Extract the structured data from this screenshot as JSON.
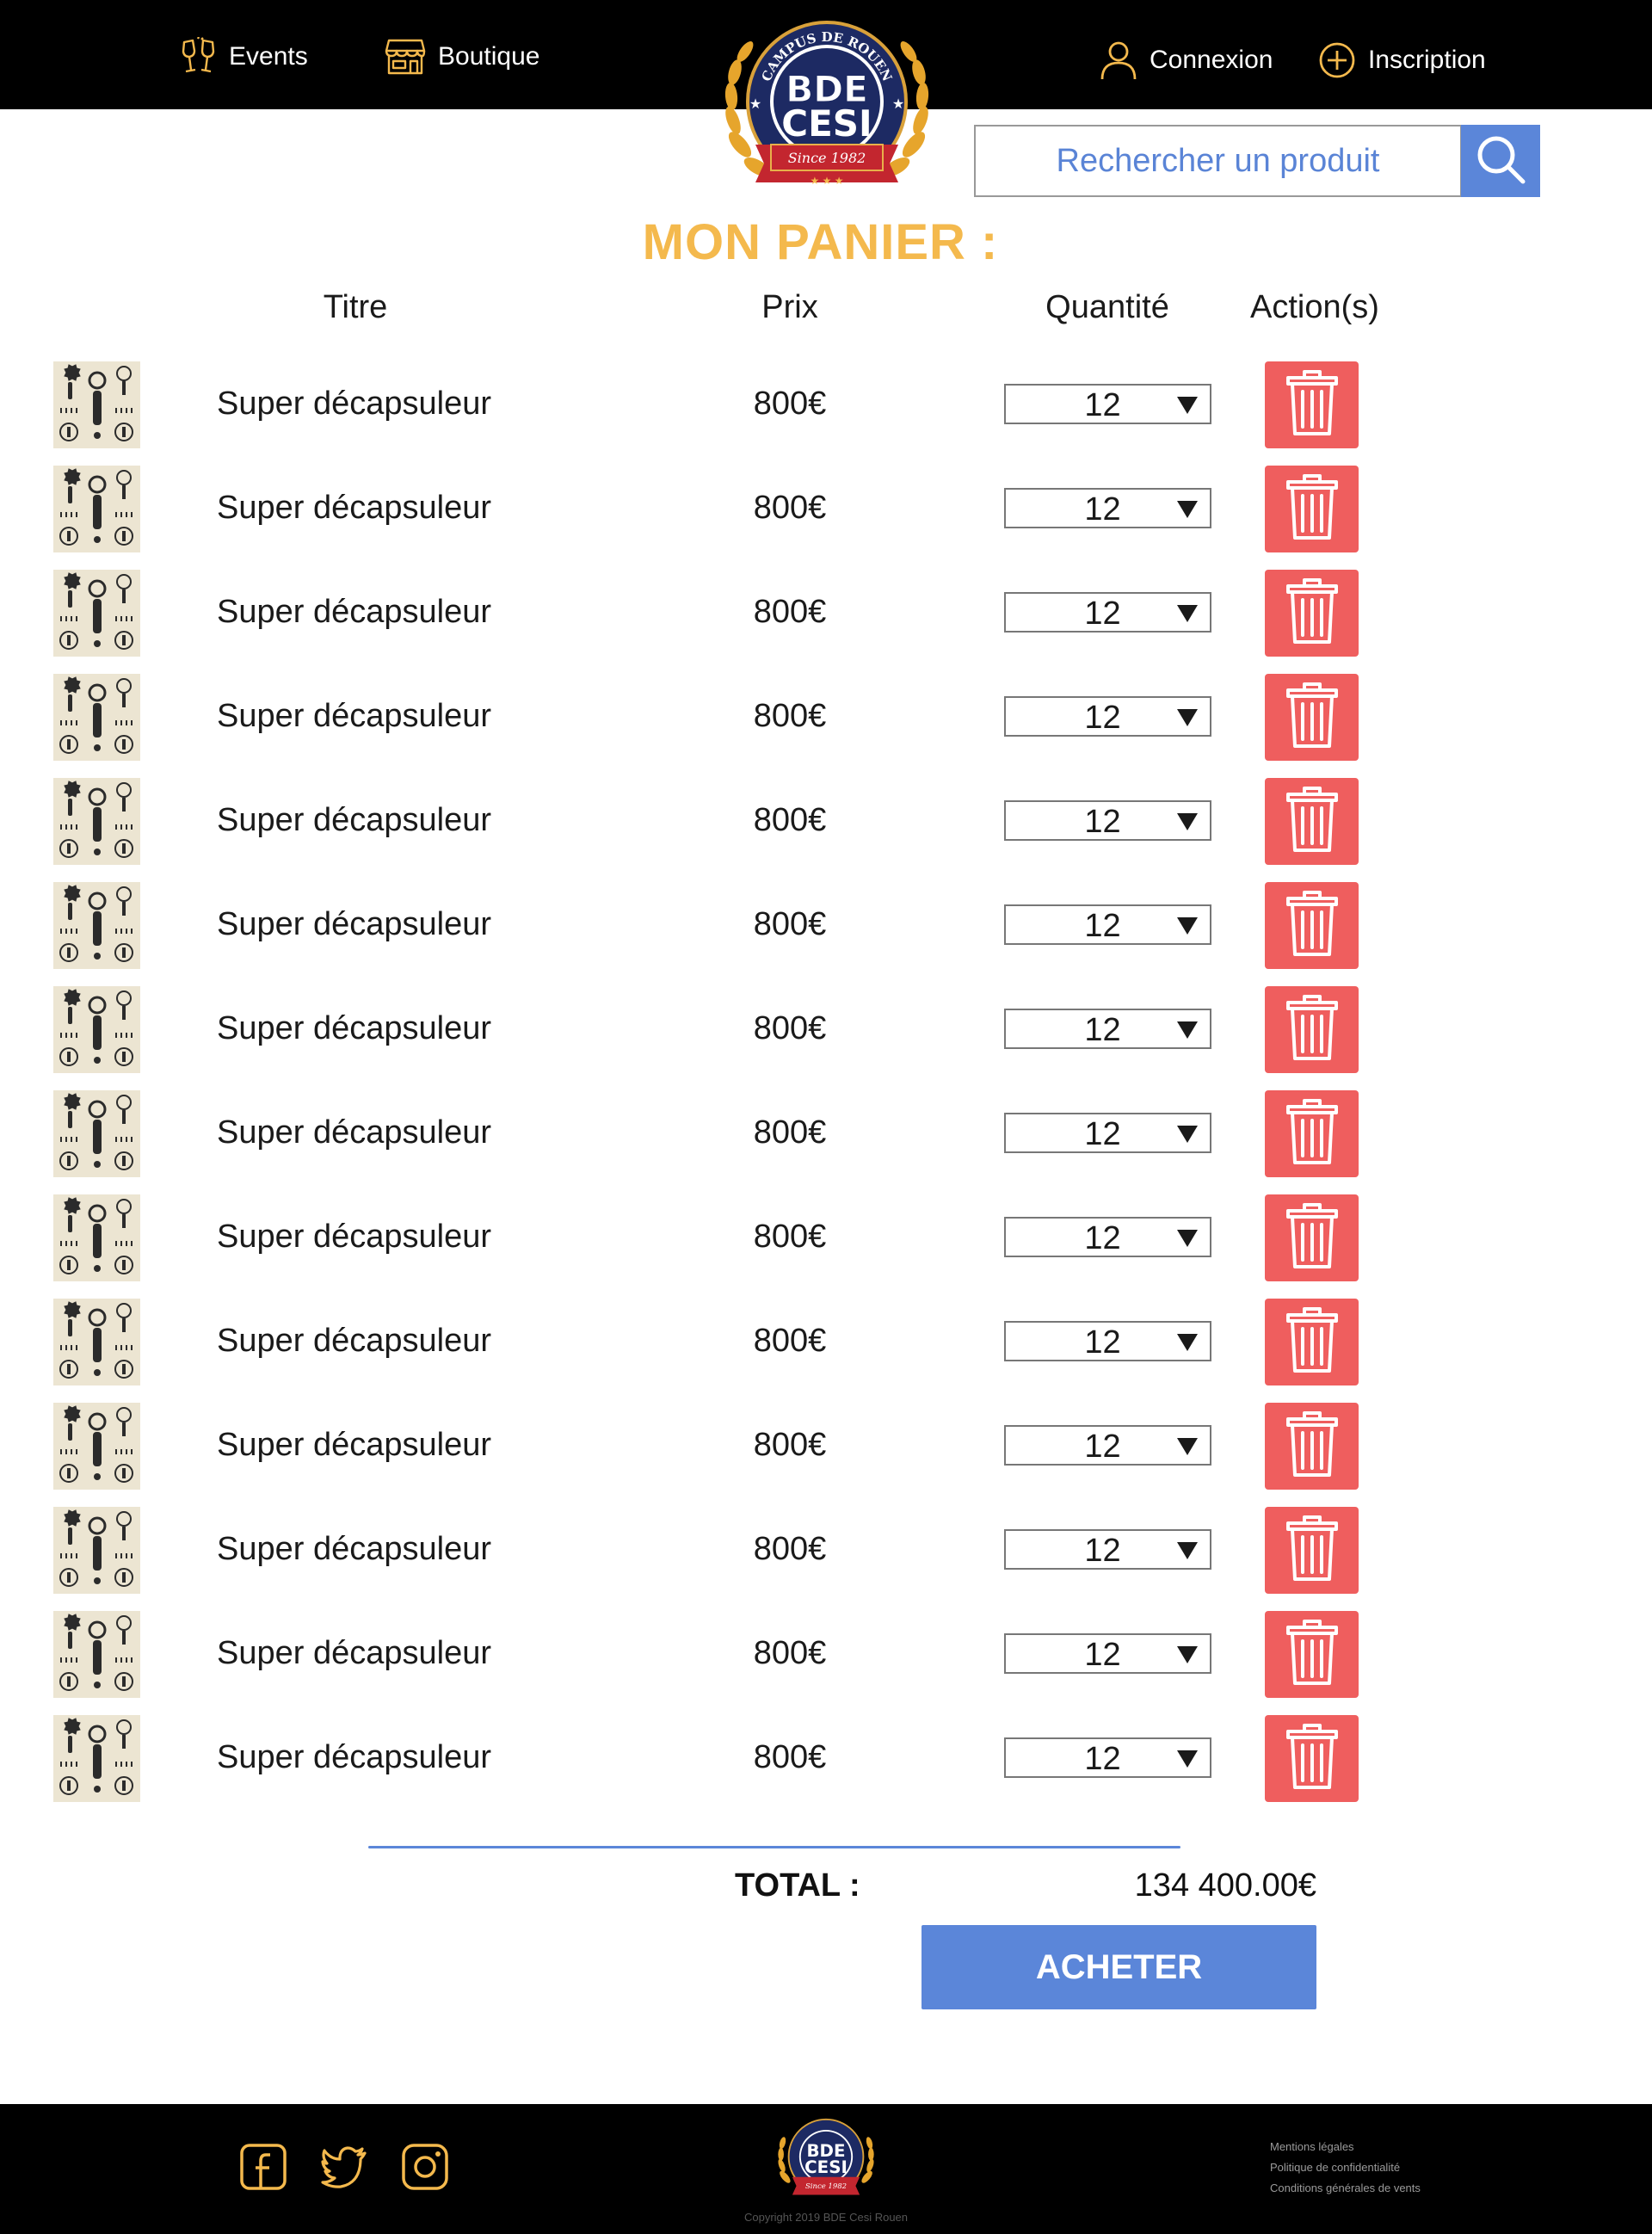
{
  "nav": {
    "events_label": "Events",
    "boutique_label": "Boutique",
    "connexion_label": "Connexion",
    "inscription_label": "Inscription"
  },
  "logo": {
    "top_text": "CAMPUS DE ROUEN",
    "main_line1": "BDE",
    "main_line2": "CESI",
    "banner": "Since 1982"
  },
  "search": {
    "placeholder": "Rechercher un produit"
  },
  "page_title": "MON PANIER :",
  "columns": {
    "titre": "Titre",
    "prix": "Prix",
    "quantite": "Quantité",
    "actions": "Action(s)"
  },
  "cart": {
    "items": [
      {
        "title": "Super décapsuleur",
        "price": "800€",
        "qty": "12"
      },
      {
        "title": "Super décapsuleur",
        "price": "800€",
        "qty": "12"
      },
      {
        "title": "Super décapsuleur",
        "price": "800€",
        "qty": "12"
      },
      {
        "title": "Super décapsuleur",
        "price": "800€",
        "qty": "12"
      },
      {
        "title": "Super décapsuleur",
        "price": "800€",
        "qty": "12"
      },
      {
        "title": "Super décapsuleur",
        "price": "800€",
        "qty": "12"
      },
      {
        "title": "Super décapsuleur",
        "price": "800€",
        "qty": "12"
      },
      {
        "title": "Super décapsuleur",
        "price": "800€",
        "qty": "12"
      },
      {
        "title": "Super décapsuleur",
        "price": "800€",
        "qty": "12"
      },
      {
        "title": "Super décapsuleur",
        "price": "800€",
        "qty": "12"
      },
      {
        "title": "Super décapsuleur",
        "price": "800€",
        "qty": "12"
      },
      {
        "title": "Super décapsuleur",
        "price": "800€",
        "qty": "12"
      },
      {
        "title": "Super décapsuleur",
        "price": "800€",
        "qty": "12"
      },
      {
        "title": "Super décapsuleur",
        "price": "800€",
        "qty": "12"
      }
    ]
  },
  "total": {
    "label": "TOTAL :",
    "value": "134 400.00€"
  },
  "buy_label": "ACHETER",
  "footer": {
    "copyright": "Copyright 2019 BDE Cesi Rouen",
    "legal": [
      "Mentions légales",
      "Politique de confidentialité",
      "Conditions générales de vents"
    ]
  },
  "colors": {
    "accent_gold": "#f4b94d",
    "primary_blue": "#5b86d9",
    "delete_red": "#ef5e5e",
    "header_bg": "#000000"
  },
  "icons": {
    "events": "champagne-glasses-icon",
    "boutique": "shop-icon",
    "connexion": "user-icon",
    "inscription": "plus-circle-icon",
    "search": "search-icon",
    "delete": "trash-icon",
    "social": [
      "facebook-icon",
      "twitter-icon",
      "instagram-icon"
    ]
  }
}
